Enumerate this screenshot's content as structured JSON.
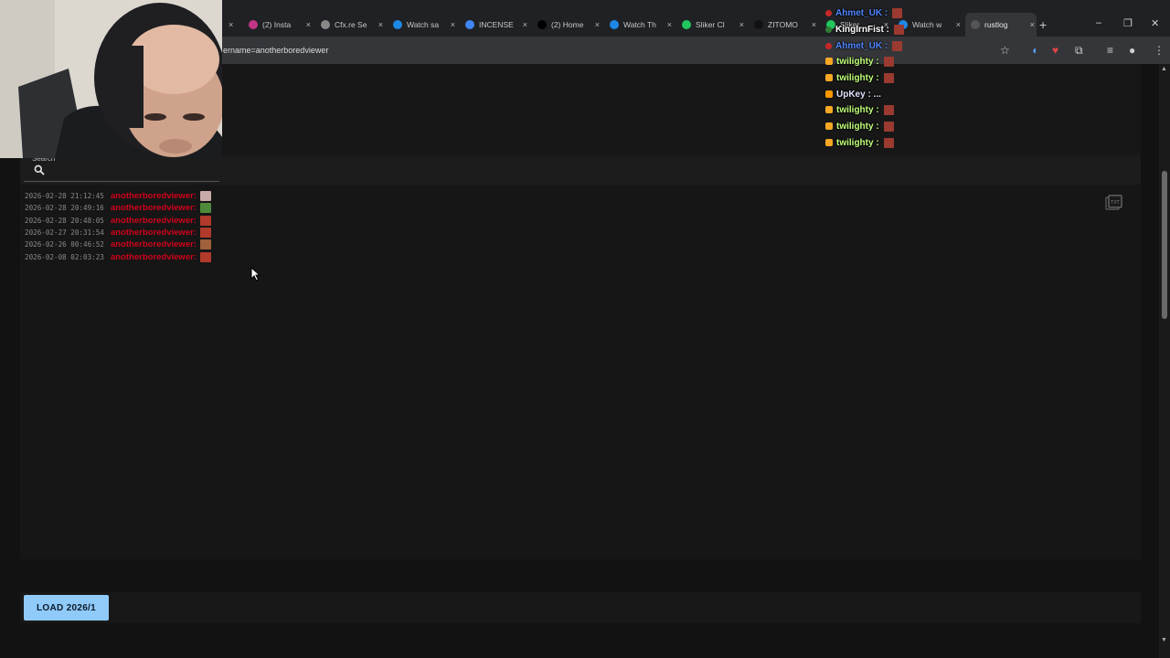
{
  "browser": {
    "tabs": [
      {
        "label": "(2) Insta",
        "color": "#c13584"
      },
      {
        "label": "Cfx.re Se",
        "color": "#888888"
      },
      {
        "label": "Watch sa",
        "color": "#1e88e5"
      },
      {
        "label": "INCENSE",
        "color": "#4285f4"
      },
      {
        "label": "(2) Home",
        "color": "#000000"
      },
      {
        "label": "Watch Th",
        "color": "#1e88e5"
      },
      {
        "label": "Sliker Cl",
        "color": "#22c55e"
      },
      {
        "label": "ZITOMO",
        "color": "#111111"
      },
      {
        "label": "Sliker",
        "color": "#22c55e"
      },
      {
        "label": "Watch w",
        "color": "#1e88e5"
      },
      {
        "label": "rustlog",
        "color": "#555555",
        "active": true
      }
    ],
    "new_tab": "+",
    "close": "×",
    "minimize": "–",
    "maximize": "❐",
    "close_window": "✕",
    "url": "ername=anotherboredviewer"
  },
  "search": {
    "label": "Search",
    "value": ""
  },
  "logs": [
    {
      "timestamp": "2026-02-28 21:12:45",
      "username": "anotherboredviewer:",
      "emote_color": "#c9a9a9"
    },
    {
      "timestamp": "2026-02-28 20:49:16",
      "username": "anotherboredviewer:",
      "emote_color": "#4f8a3a"
    },
    {
      "timestamp": "2026-02-28 20:48:05",
      "username": "anotherboredviewer:",
      "emote_color": "#b23a2a"
    },
    {
      "timestamp": "2026-02-27 20:31:54",
      "username": "anotherboredviewer:",
      "emote_color": "#b23a2a"
    },
    {
      "timestamp": "2026-02-26 00:46:52",
      "username": "anotherboredviewer:",
      "emote_color": "#a0603a"
    },
    {
      "timestamp": "2026-02-08 02:03:23",
      "username": "anotherboredviewer:",
      "emote_color": "#b23a2a"
    }
  ],
  "load_button": "LOAD 2026/1",
  "chat": [
    {
      "user": "Ahmet_UK :",
      "color": "#4f86ff",
      "badge": "dot-red"
    },
    {
      "user": "KingIrnFist :",
      "color": "#ffffff",
      "badge": "dot-green"
    },
    {
      "user": "Ahmet_UK :",
      "color": "#4f86ff",
      "badge": "dot-red"
    },
    {
      "user": "twilighty :",
      "color": "#bfff7a",
      "badge": "sq-yellow"
    },
    {
      "user": "twilighty :",
      "color": "#bfff7a",
      "badge": "sq-yellow"
    },
    {
      "user": "UpKey : ...",
      "color": "#e0e0ff",
      "badge": "sq-orange"
    },
    {
      "user": "twilighty :",
      "color": "#bfff7a",
      "badge": "sq-yellow"
    },
    {
      "user": "twilighty :",
      "color": "#bfff7a",
      "badge": "sq-yellow"
    },
    {
      "user": "twilighty :",
      "color": "#bfff7a",
      "badge": "sq-yellow"
    }
  ],
  "colors": {
    "username": "#d0021b",
    "button": "#90caf9",
    "background": "#121212"
  }
}
